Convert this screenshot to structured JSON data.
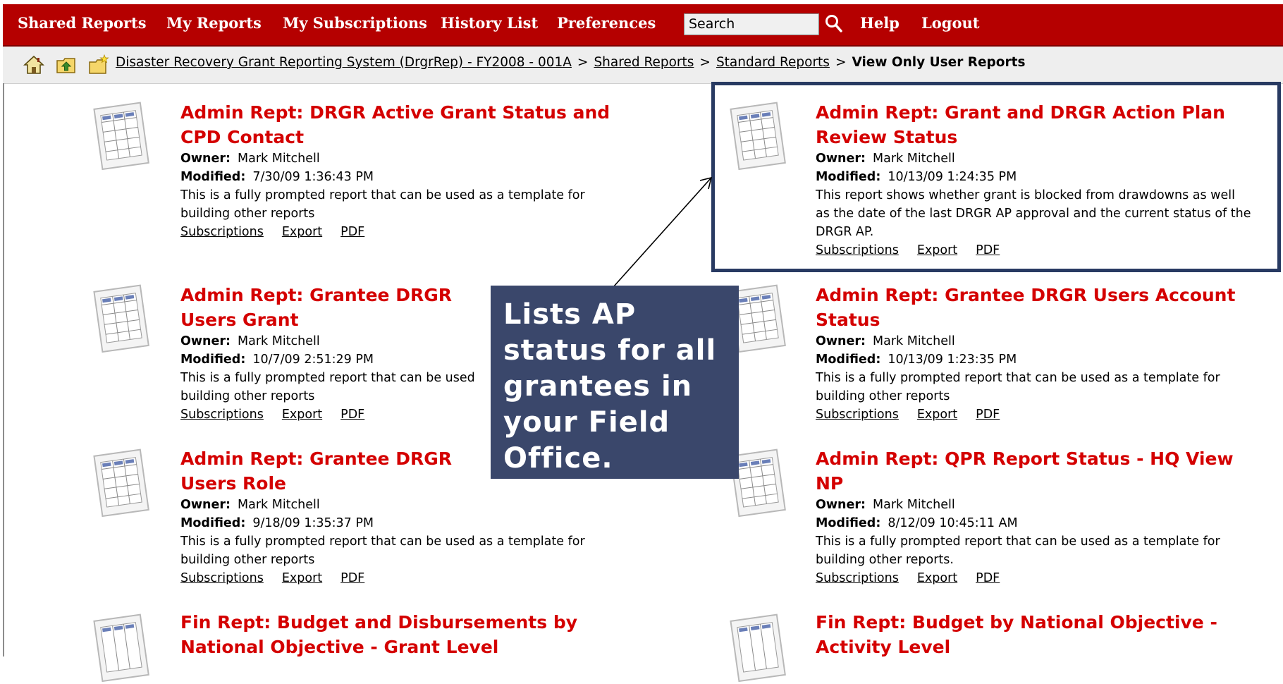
{
  "nav": {
    "shared_reports": "Shared Reports",
    "my_reports": "My Reports",
    "my_subscriptions": "My Subscriptions",
    "history_list": "History List",
    "preferences": "Preferences",
    "search_placeholder": "Search",
    "help": "Help",
    "logout": "Logout"
  },
  "breadcrumb": {
    "root": "Disaster Recovery Grant Reporting System (DrgrRep) - FY2008 - 001A",
    "shared": "Shared Reports",
    "standard": "Standard Reports",
    "current": "View Only User Reports",
    "separator": ">"
  },
  "labels": {
    "owner": "Owner:",
    "modified": "Modified:",
    "subscriptions": "Subscriptions",
    "export": "Export",
    "pdf": "PDF"
  },
  "reports": [
    {
      "title": "Admin Rept: DRGR Active Grant Status and CPD Contact",
      "owner": "Mark Mitchell",
      "modified": "7/30/09 1:36:43 PM",
      "description": "This is a fully prompted report that can be used as a template for building other reports"
    },
    {
      "title": "Admin Rept: Grant and DRGR Action Plan Review Status",
      "owner": "Mark Mitchell",
      "modified": "10/13/09 1:24:35 PM",
      "description": "This report shows whether grant is blocked from drawdowns as well as the date of the last DRGR AP approval and the current status of the DRGR AP."
    },
    {
      "title": "Admin Rept: Grantee DRGR Users Grant",
      "owner": "Mark Mitchell",
      "modified": "10/7/09 2:51:29 PM",
      "description": "This is a fully prompted report that can be used building other reports"
    },
    {
      "title": "Admin Rept: Grantee DRGR Users Account Status",
      "owner": "Mark Mitchell",
      "modified": "10/13/09 1:23:35 PM",
      "description": "This is a fully prompted report that can be used as a template for building other reports"
    },
    {
      "title": "Admin Rept: Grantee DRGR Users Role",
      "owner": "Mark Mitchell",
      "modified": "9/18/09 1:35:37 PM",
      "description": "This is a fully prompted report that can be used as a template for building other reports"
    },
    {
      "title": "Admin Rept: QPR Report Status - HQ View NP",
      "owner": "Mark Mitchell",
      "modified": "8/12/09 10:45:11 AM",
      "description": "This is a fully prompted report that can be used as a template for building other reports."
    },
    {
      "title": "Fin Rept: Budget and Disbursements by National Objective - Grant Level"
    },
    {
      "title": "Fin Rept: Budget by National Objective - Activity Level"
    }
  ],
  "callout": {
    "text": "Lists AP status for all grantees in your Field Office."
  },
  "colors": {
    "nav_bg": "#b50000",
    "title_red": "#d40000",
    "callout_bg": "#3a476b",
    "highlight_border": "#283a62"
  }
}
